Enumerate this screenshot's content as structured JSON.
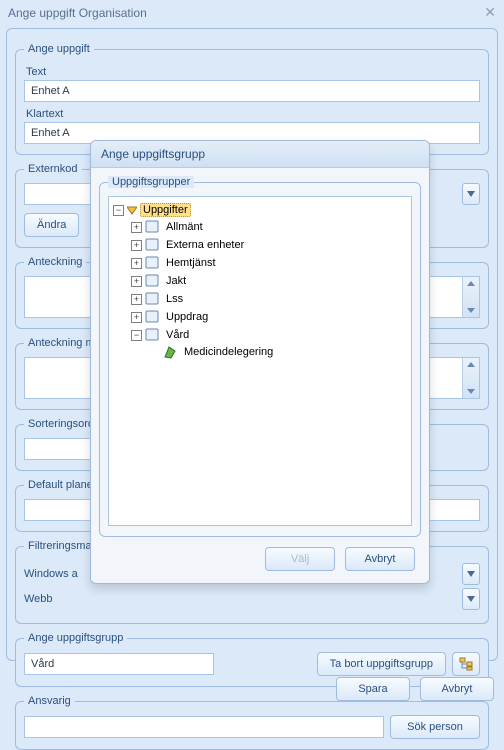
{
  "window": {
    "title": "Ange uppgift Organisation"
  },
  "main": {
    "legend": "Ange uppgift",
    "text_label": "Text",
    "text_value": "Enhet A",
    "klartext_label": "Klartext",
    "klartext_value": "Enhet A"
  },
  "externkod": {
    "legend": "Externkod",
    "value": "",
    "andra_label": "Ändra"
  },
  "anteckning": {
    "legend": "Anteckning"
  },
  "anteckning_mobil": {
    "legend": "Anteckning m"
  },
  "sortering": {
    "legend": "Sorteringsord"
  },
  "default_plane": {
    "legend": "Default plane"
  },
  "filtrering": {
    "legend": "Filtreringsmall",
    "row1_label": "Windows a",
    "row2_label": "Webb"
  },
  "ange_uppgiftsgrupp": {
    "legend": "Ange uppgiftsgrupp",
    "value": "Vård",
    "remove_label": "Ta bort uppgiftsgrupp"
  },
  "ansvarig": {
    "legend": "Ansvarig",
    "value": "",
    "sok_label": "Sök person"
  },
  "footer": {
    "save": "Spara",
    "cancel": "Avbryt"
  },
  "popup": {
    "title": "Ange uppgiftsgrupp",
    "group_legend": "Uppgiftsgrupper",
    "root_label": "Uppgifter",
    "nodes": {
      "allmant": "Allmänt",
      "externa": "Externa enheter",
      "hemtjanst": "Hemtjänst",
      "jakt": "Jakt",
      "lss": "Lss",
      "uppdrag": "Uppdrag",
      "vard": "Vård",
      "medicin": "Medicindelegering"
    },
    "valj": "Välj",
    "avbryt": "Avbryt"
  }
}
